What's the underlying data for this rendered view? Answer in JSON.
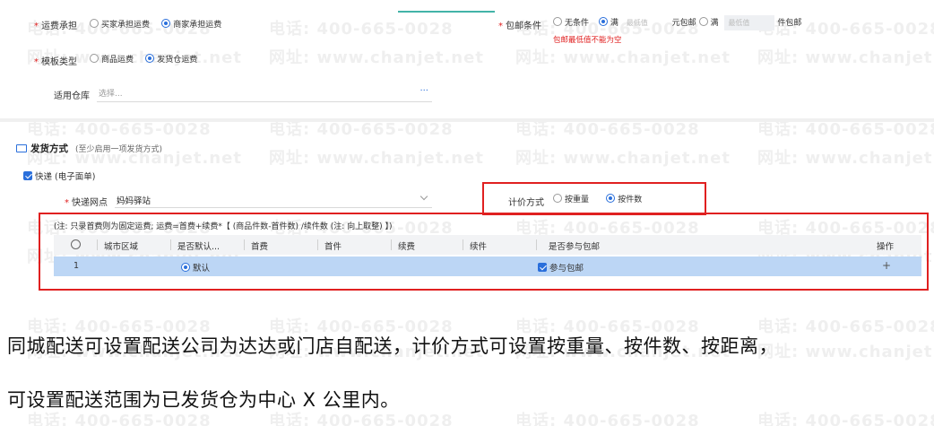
{
  "watermark": {
    "phone": "电话: 400-665-0028",
    "site": "网址: www.chanjet.net"
  },
  "freight": {
    "label": "运费承担",
    "options": [
      "买家承担运费",
      "商家承担运费"
    ],
    "selected": "商家承担运费"
  },
  "template_type": {
    "label": "模板类型",
    "options": [
      "商品运费",
      "发货仓运费"
    ],
    "selected": "发货仓运费"
  },
  "warehouse": {
    "label": "适用仓库",
    "placeholder": "选择...",
    "more": "···"
  },
  "free_shipping": {
    "label": "包邮条件",
    "opt_none": "无条件",
    "opt_full1": "满",
    "min_placeholder1": "最低值",
    "unit1": "元包邮",
    "opt_full2": "满",
    "min_placeholder2": "最低值",
    "unit2": "件包邮",
    "error": "包邮最低值不能为空"
  },
  "shipping_method": {
    "title": "发货方式",
    "subtitle": "(至少启用一项发货方式)",
    "express_label": "快递 (电子面单)",
    "outlet_label": "快递网点",
    "outlet_value": "妈妈驿站",
    "pricing_label": "计价方式",
    "pricing_options": [
      "按重量",
      "按件数"
    ],
    "pricing_selected": "按件数"
  },
  "table": {
    "note": "(注: 只录首费则为固定运费; 运费=首费+续费*【 (商品件数-首件数) /续件数 (注: 向上取整) 】)",
    "headers": [
      "城市区域",
      "是否默认...",
      "首费",
      "首件",
      "续费",
      "续件",
      "是否参与包邮",
      "操作"
    ],
    "rows": [
      {
        "index": "1",
        "default": "默认",
        "free_shipping": "参与包邮",
        "action": "+"
      }
    ]
  },
  "paragraph": {
    "line1": "同城配送可设置配送公司为达达或门店自配送，计价方式可设置按重量、按件数、按距离，",
    "line2": "可设置配送范围为已发货仓为中心 X 公里内。"
  },
  "colors": {
    "accent": "#2a6fdb",
    "required": "#e02020",
    "row_highlight": "#bcd6f5"
  }
}
